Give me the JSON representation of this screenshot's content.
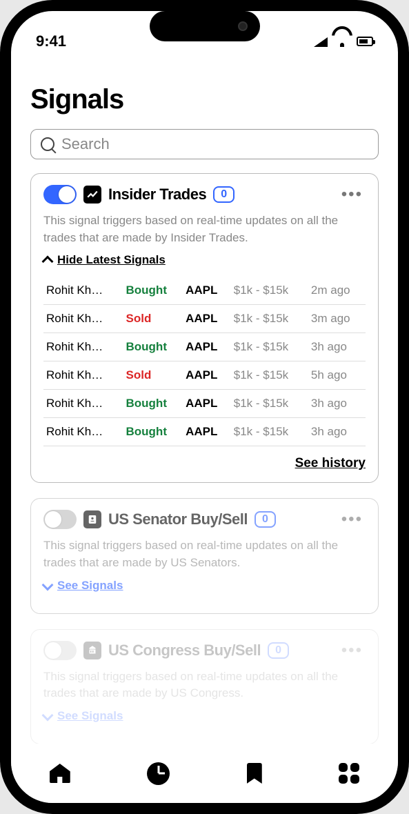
{
  "status": {
    "time": "9:41"
  },
  "page": {
    "title": "Signals"
  },
  "search": {
    "placeholder": "Search"
  },
  "cards": [
    {
      "enabled": true,
      "title": "Insider Trades",
      "badge": "0",
      "description": "This signal triggers based on real-time updates on all the trades that are made by Insider Trades.",
      "toggle_label": "Hide Latest Signals",
      "trades": [
        {
          "name": "Rohit Kh…",
          "action": "Bought",
          "symbol": "AAPL",
          "amount": "$1k - $15k",
          "time": "2m ago"
        },
        {
          "name": "Rohit Kh…",
          "action": "Sold",
          "symbol": "AAPL",
          "amount": "$1k - $15k",
          "time": "3m ago"
        },
        {
          "name": "Rohit Kh…",
          "action": "Bought",
          "symbol": "AAPL",
          "amount": "$1k - $15k",
          "time": "3h ago"
        },
        {
          "name": "Rohit Kh…",
          "action": "Sold",
          "symbol": "AAPL",
          "amount": "$1k - $15k",
          "time": "5h ago"
        },
        {
          "name": "Rohit Kh…",
          "action": "Bought",
          "symbol": "AAPL",
          "amount": "$1k - $15k",
          "time": "3h ago"
        },
        {
          "name": "Rohit Kh…",
          "action": "Bought",
          "symbol": "AAPL",
          "amount": "$1k - $15k",
          "time": "3h ago"
        }
      ],
      "see_history": "See history"
    },
    {
      "enabled": false,
      "title": "US Senator Buy/Sell",
      "badge": "0",
      "description": "This signal triggers based on real-time updates on all the trades that are made by US Senators.",
      "see_signals": "See Signals"
    },
    {
      "enabled": false,
      "title": "US Congress Buy/Sell",
      "badge": "0",
      "description": "This signal triggers based on real-time updates on all the trades that are made by US Congress.",
      "see_signals": "See Signals"
    }
  ]
}
